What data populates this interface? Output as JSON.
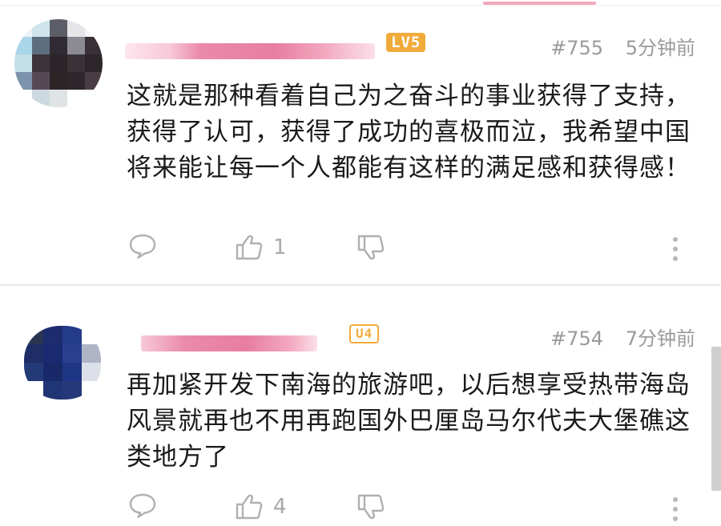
{
  "comments": [
    {
      "level": "LV5",
      "floor": "#755",
      "time": "5分钟前",
      "text": "这就是那种看着自己为之奋斗的事业获得了支持，获得了认可，获得了成功的喜极而泣，我希望中国将来能让每一个人都能有这样的满足感和获得感！",
      "likes": "1"
    },
    {
      "level": "U4",
      "floor": "#754",
      "time": "7分钟前",
      "text": "再加紧开发下南海的旅游吧，以后想享受热带海岛风景就再也不用再跑国外巴厘岛马尔代夫大堡礁这类地方了",
      "likes": "4"
    }
  ],
  "icons": {
    "reply": "speech-bubble-icon",
    "like": "thumbs-up-icon",
    "dislike": "thumbs-down-icon",
    "more": "vertical-ellipsis-icon"
  },
  "colors": {
    "accent": "#f3a9bb",
    "level_badge": "#f1ab3a",
    "meta_text": "#9a9a9a",
    "icon": "#a8a8a8"
  }
}
